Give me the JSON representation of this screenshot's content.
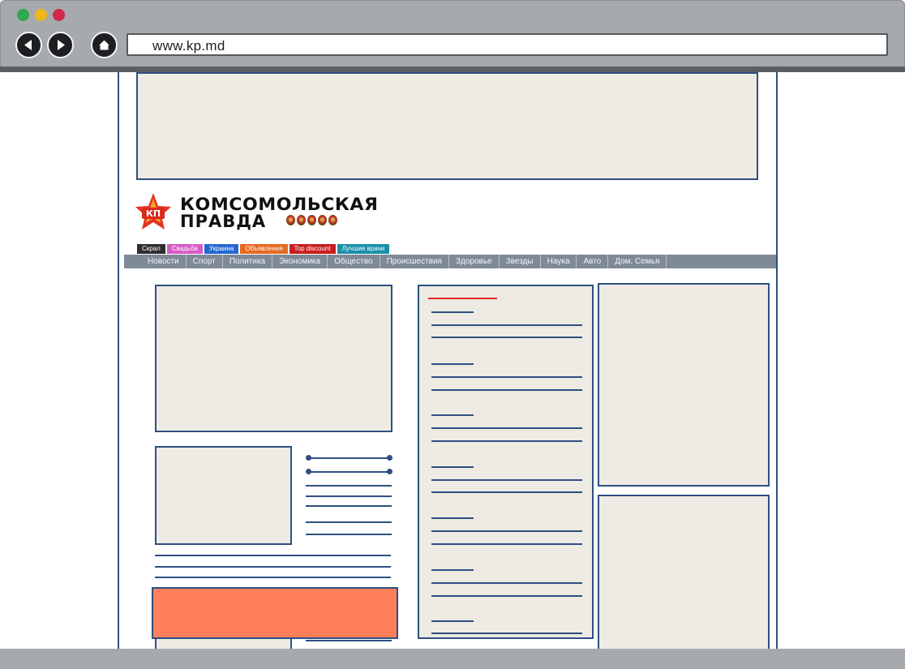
{
  "browser": {
    "url": "www.kp.md",
    "traffic_lights": [
      "#2fa84f",
      "#f1b51c",
      "#d0284a"
    ]
  },
  "site": {
    "logo": {
      "badge_text": "КП",
      "name_line1": "КОМСОМОЛЬСКАЯ",
      "name_line2": "ПРАВДА"
    },
    "tabs": [
      {
        "label": "Скрал",
        "color": "#2e2e2e"
      },
      {
        "label": "Свадьба",
        "color": "#d65cc4"
      },
      {
        "label": "Украина",
        "color": "#2366d1"
      },
      {
        "label": "Объявления",
        "color": "#e66a1f"
      },
      {
        "label": "Top discount",
        "color": "#c81d1d"
      },
      {
        "label": "Лучшие врачи",
        "color": "#1b8fa8"
      }
    ],
    "menu": [
      "Новости",
      "Спорт",
      "Политика",
      "Экономика",
      "Общество",
      "Происшествия",
      "Здоровье",
      "Звезды",
      "Наука",
      "Авто",
      "Дом. Семья"
    ]
  },
  "colors": {
    "accent_blue": "#2f4f82",
    "placeholder_fill": "#edebe3",
    "ad_orange": "#ff7f5b",
    "headline_red": "#e02b1f"
  }
}
